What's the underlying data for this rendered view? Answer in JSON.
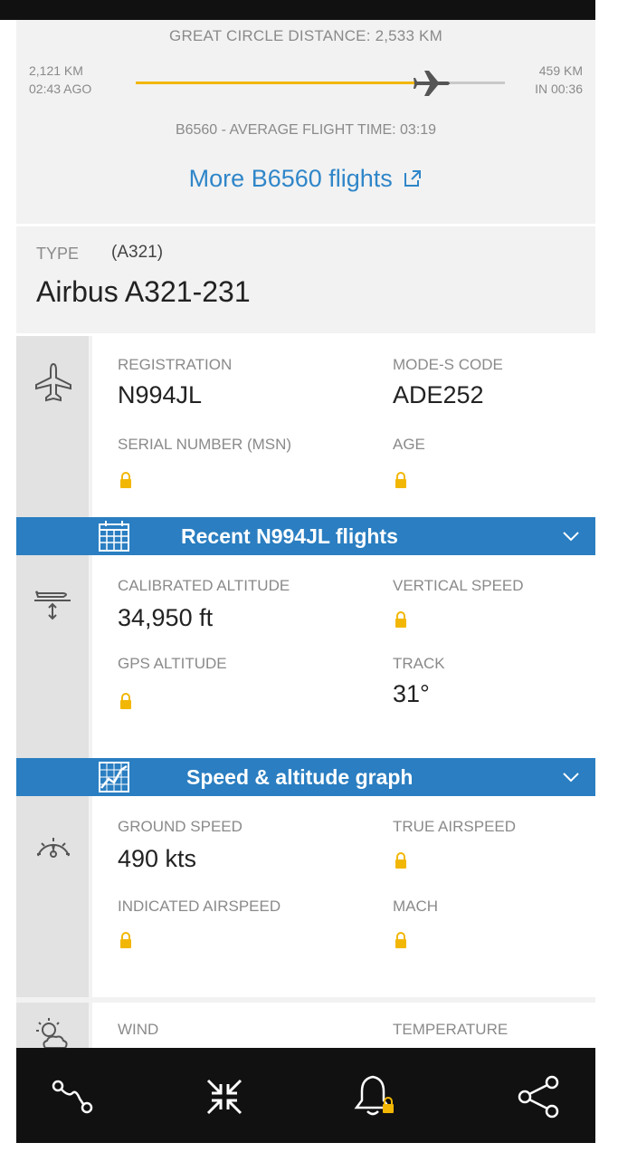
{
  "route": {
    "great_circle": "GREAT CIRCLE DISTANCE: 2,533 KM",
    "flown_distance": "2,121 KM",
    "flown_time": "02:43 AGO",
    "remaining_distance": "459 KM",
    "remaining_time": "IN 00:36",
    "progress_fraction": 0.83,
    "average_flight_time": "B6560 - AVERAGE FLIGHT TIME: 03:19",
    "more_flights_link": "More B6560 flights"
  },
  "aircraft_type": {
    "label": "TYPE",
    "code": "(A321)",
    "name": "Airbus A321-231"
  },
  "aircraft": {
    "registration_label": "REGISTRATION",
    "registration_value": "N994JL",
    "modes_label": "MODE-S CODE",
    "modes_value": "ADE252",
    "serial_label": "SERIAL NUMBER (MSN)",
    "age_label": "AGE"
  },
  "recent_flights_bar": {
    "label": "Recent N994JL flights"
  },
  "altitude": {
    "calibrated_label": "CALIBRATED ALTITUDE",
    "calibrated_value": "34,950 ft",
    "vertical_speed_label": "VERTICAL SPEED",
    "gps_label": "GPS ALTITUDE",
    "track_label": "TRACK",
    "track_value": "31°"
  },
  "graph_bar": {
    "label": "Speed & altitude graph"
  },
  "speed": {
    "ground_label": "GROUND SPEED",
    "ground_value": "490 kts",
    "true_label": "TRUE AIRSPEED",
    "indicated_label": "INDICATED AIRSPEED",
    "mach_label": "MACH"
  },
  "weather": {
    "wind_label": "WIND",
    "temperature_label": "TEMPERATURE"
  },
  "icons": {
    "toolbar": [
      "route-icon",
      "collapse-icon",
      "alert-bell-icon",
      "share-icon"
    ]
  },
  "colors": {
    "accent_blue": "#2a7ec1",
    "progress_yellow": "#f2b705",
    "lock_yellow": "#f2b705",
    "link_blue": "#2f86c9"
  }
}
